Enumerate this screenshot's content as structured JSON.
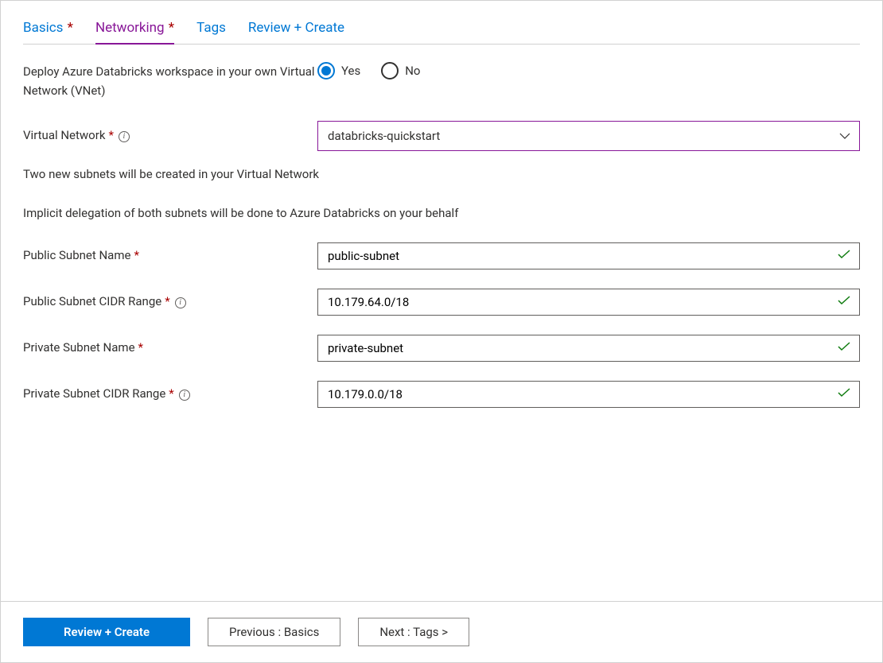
{
  "tabs": {
    "basics": "Basics",
    "networking": "Networking",
    "tags": "Tags",
    "review": "Review + Create"
  },
  "form": {
    "vnet_toggle_label": "Deploy Azure Databricks workspace in your own Virtual Network (VNet)",
    "yes_label": "Yes",
    "no_label": "No",
    "vnet_label": "Virtual Network",
    "vnet_value": "databricks-quickstart",
    "info_line1": "Two new subnets will be created in your Virtual Network",
    "info_line2": "Implicit delegation of both subnets will be done to Azure Databricks on your behalf",
    "public_subnet_name_label": "Public Subnet Name",
    "public_subnet_name_value": "public-subnet",
    "public_subnet_cidr_label": "Public Subnet CIDR Range",
    "public_subnet_cidr_value": "10.179.64.0/18",
    "private_subnet_name_label": "Private Subnet Name",
    "private_subnet_name_value": "private-subnet",
    "private_subnet_cidr_label": "Private Subnet CIDR Range",
    "private_subnet_cidr_value": "10.179.0.0/18"
  },
  "footer": {
    "review_create": "Review + Create",
    "previous": "Previous : Basics",
    "next": "Next : Tags >"
  }
}
